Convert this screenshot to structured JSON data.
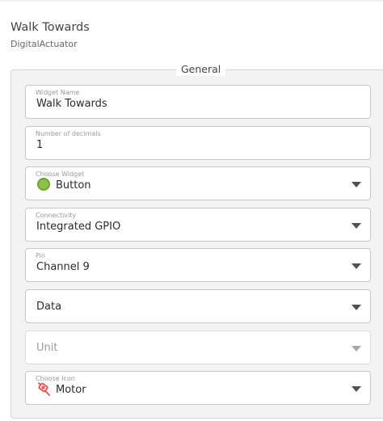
{
  "header": {
    "title": "Walk Towards",
    "subtitle": "DigitalActuator"
  },
  "section": {
    "legend": "General"
  },
  "fields": {
    "widget_name": {
      "label": "Widget Name",
      "value": "Walk Towards"
    },
    "decimals": {
      "label": "Number of decimals",
      "value": "1"
    },
    "widget": {
      "label": "Choose Widget",
      "value": "Button",
      "icon": "green-circle-icon",
      "icon_color": "#8bc34a"
    },
    "connectivity": {
      "label": "Connectivity",
      "value": "Integrated GPIO"
    },
    "pin": {
      "label": "Pin",
      "value": "Channel 9"
    },
    "data": {
      "value": "Data"
    },
    "unit": {
      "value": "Unit"
    },
    "icon": {
      "label": "Choose Icon",
      "value": "Motor",
      "icon": "motor-icon",
      "icon_color": "#e0524a"
    }
  }
}
